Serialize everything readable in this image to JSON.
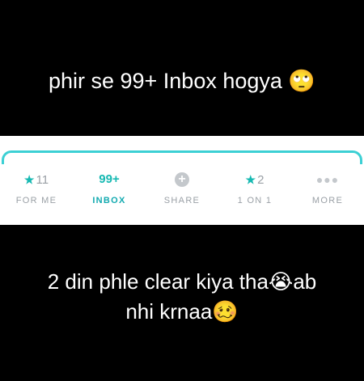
{
  "top_caption": {
    "text": "phir se 99+ Inbox hogya",
    "emoji": "🙄"
  },
  "tabs": [
    {
      "icon": "star-icon",
      "count": "11",
      "label": "FOR ME"
    },
    {
      "icon": "",
      "count": "99+",
      "label": "INBOX",
      "active": true
    },
    {
      "icon": "plus-circle-icon",
      "count": "",
      "label": "SHARE"
    },
    {
      "icon": "star-icon",
      "count": "2",
      "label": "1 ON 1"
    },
    {
      "icon": "more-dots-icon",
      "count": "",
      "label": "MORE"
    }
  ],
  "bottom_caption": {
    "line1": "2 din phle clear kiya tha",
    "emoji1": "😭",
    "line1_end": "ab",
    "line2": "nhi krnaa",
    "emoji2": "🥴"
  },
  "colors": {
    "accent": "#16b9b2",
    "muted": "#9aa0a6",
    "background": "#000000"
  }
}
